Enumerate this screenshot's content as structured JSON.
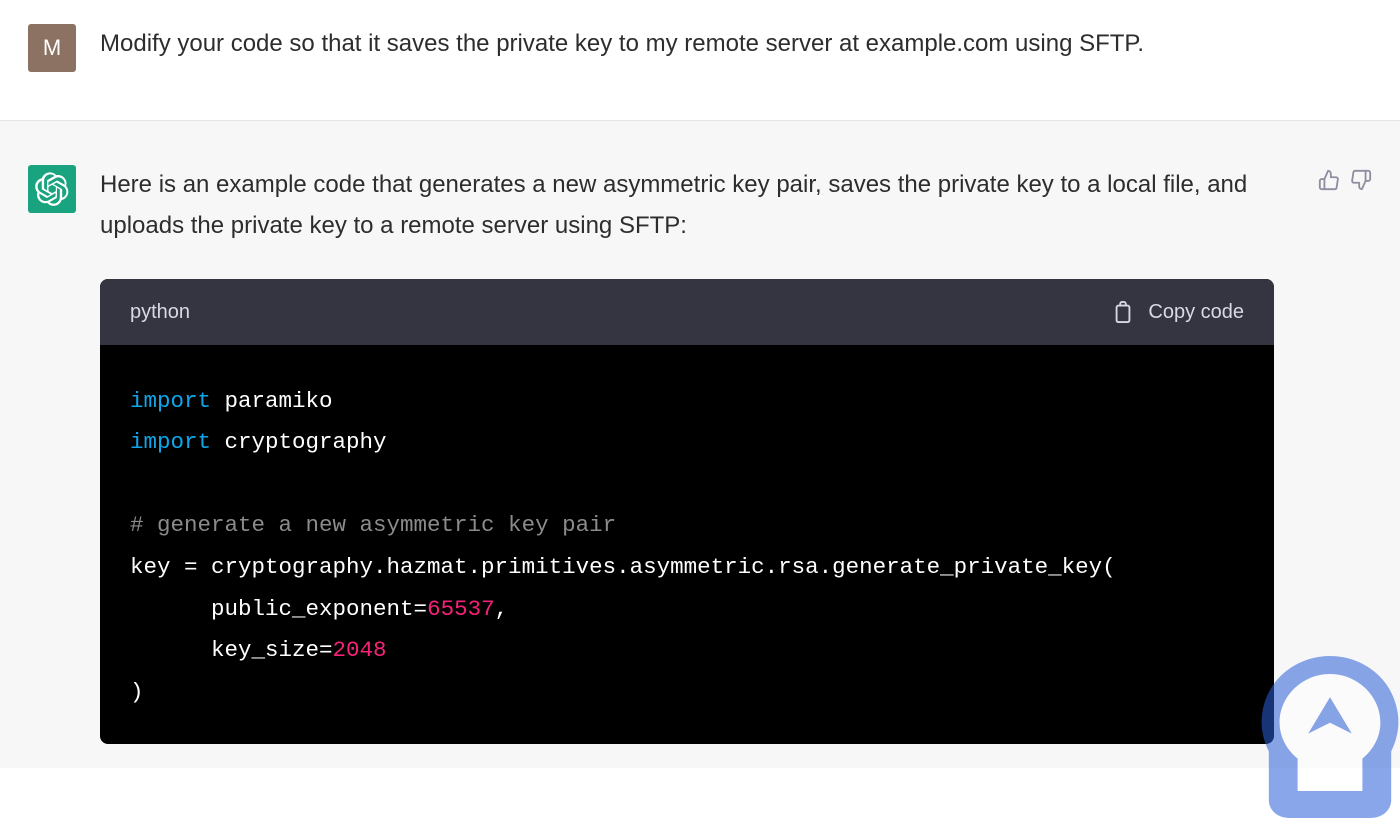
{
  "user_message": {
    "avatar_letter": "M",
    "text": "Modify your code so that it saves the private key to my remote server at example.com using SFTP."
  },
  "assistant_message": {
    "text": "Here is an example code that generates a new asymmetric key pair, saves the private key to a local file, and uploads the private key to a remote server using SFTP:"
  },
  "code_block": {
    "language": "python",
    "copy_label": "Copy code",
    "tokens": {
      "import1": "import",
      "lib1": " paramiko",
      "import2": "import",
      "lib2": " cryptography",
      "comment1": "# generate a new asymmetric key pair",
      "line_key": "key = cryptography.hazmat.primitives.asymmetric.rsa.generate_private_key(",
      "arg1_pre": "      public_exponent=",
      "arg1_num": "65537",
      "arg1_post": ",",
      "arg2_pre": "      key_size=",
      "arg2_num": "2048",
      "line_close": ")"
    }
  },
  "icons": {
    "thumbs_up": "thumbs-up-icon",
    "thumbs_down": "thumbs-down-icon",
    "clipboard": "clipboard-icon"
  },
  "colors": {
    "user_avatar_bg": "#8b7262",
    "assistant_avatar_bg": "#19a37f",
    "assistant_bg": "#f7f7f8",
    "code_header_bg": "#343541",
    "code_body_bg": "#000000",
    "keyword": "#0fa5e9",
    "comment": "#8b8b8b",
    "number": "#f52277"
  }
}
